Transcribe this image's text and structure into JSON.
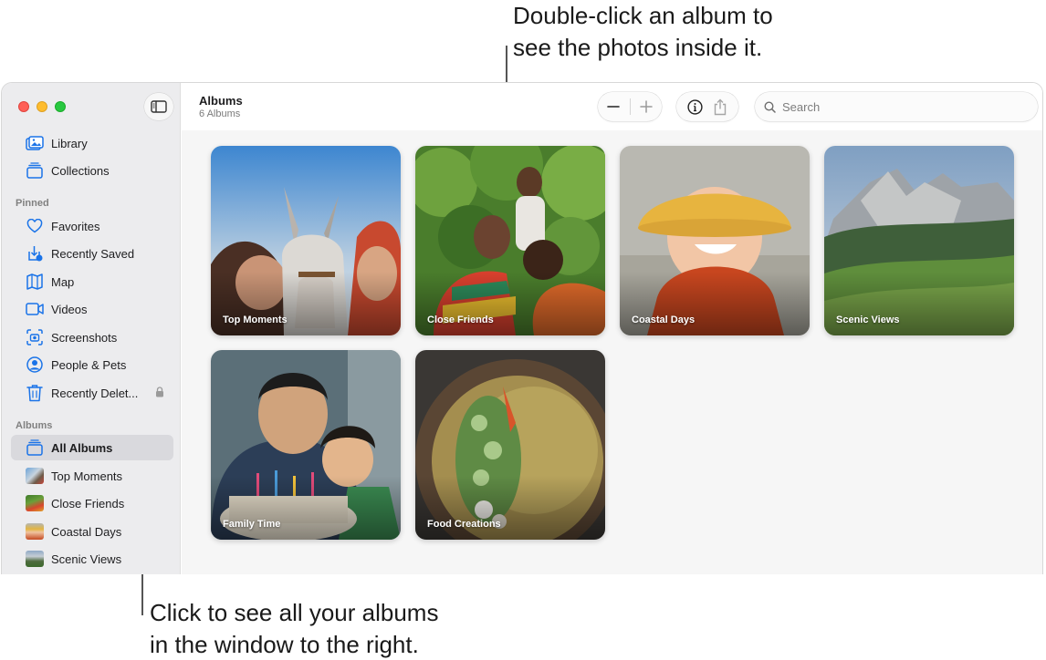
{
  "callouts": {
    "top_line1": "Double-click an album to",
    "top_line2": "see the photos inside it.",
    "bottom_line1": "Click to see all your albums",
    "bottom_line2": "in the window to the right."
  },
  "sidebar": {
    "items_main": [
      {
        "label": "Library",
        "icon": "library-icon"
      },
      {
        "label": "Collections",
        "icon": "collections-icon"
      }
    ],
    "pinned_label": "Pinned",
    "pinned": [
      {
        "label": "Favorites",
        "icon": "heart-icon"
      },
      {
        "label": "Recently Saved",
        "icon": "recently-saved-icon"
      },
      {
        "label": "Map",
        "icon": "map-icon"
      },
      {
        "label": "Videos",
        "icon": "video-icon"
      },
      {
        "label": "Screenshots",
        "icon": "screenshot-icon"
      },
      {
        "label": "People & Pets",
        "icon": "person-icon"
      },
      {
        "label": "Recently Delet...",
        "icon": "trash-icon"
      }
    ],
    "albums_label": "Albums",
    "albums": [
      {
        "label": "All Albums",
        "icon": "albums-stack-icon",
        "selected": true
      },
      {
        "label": "Top Moments"
      },
      {
        "label": "Close Friends"
      },
      {
        "label": "Coastal Days"
      },
      {
        "label": "Scenic Views"
      }
    ]
  },
  "header": {
    "title": "Albums",
    "subtitle": "6 Albums",
    "zoom_out": "−",
    "zoom_in": "+",
    "search_placeholder": "Search"
  },
  "grid": {
    "albums": [
      {
        "name": "Top Moments"
      },
      {
        "name": "Close Friends"
      },
      {
        "name": "Coastal Days"
      },
      {
        "name": "Scenic Views"
      },
      {
        "name": "Family Time"
      },
      {
        "name": "Food Creations"
      }
    ]
  },
  "colors": {
    "accent": "#1a73e8",
    "selection": "#d9d9dd",
    "sidebar_bg": "#ececee"
  }
}
